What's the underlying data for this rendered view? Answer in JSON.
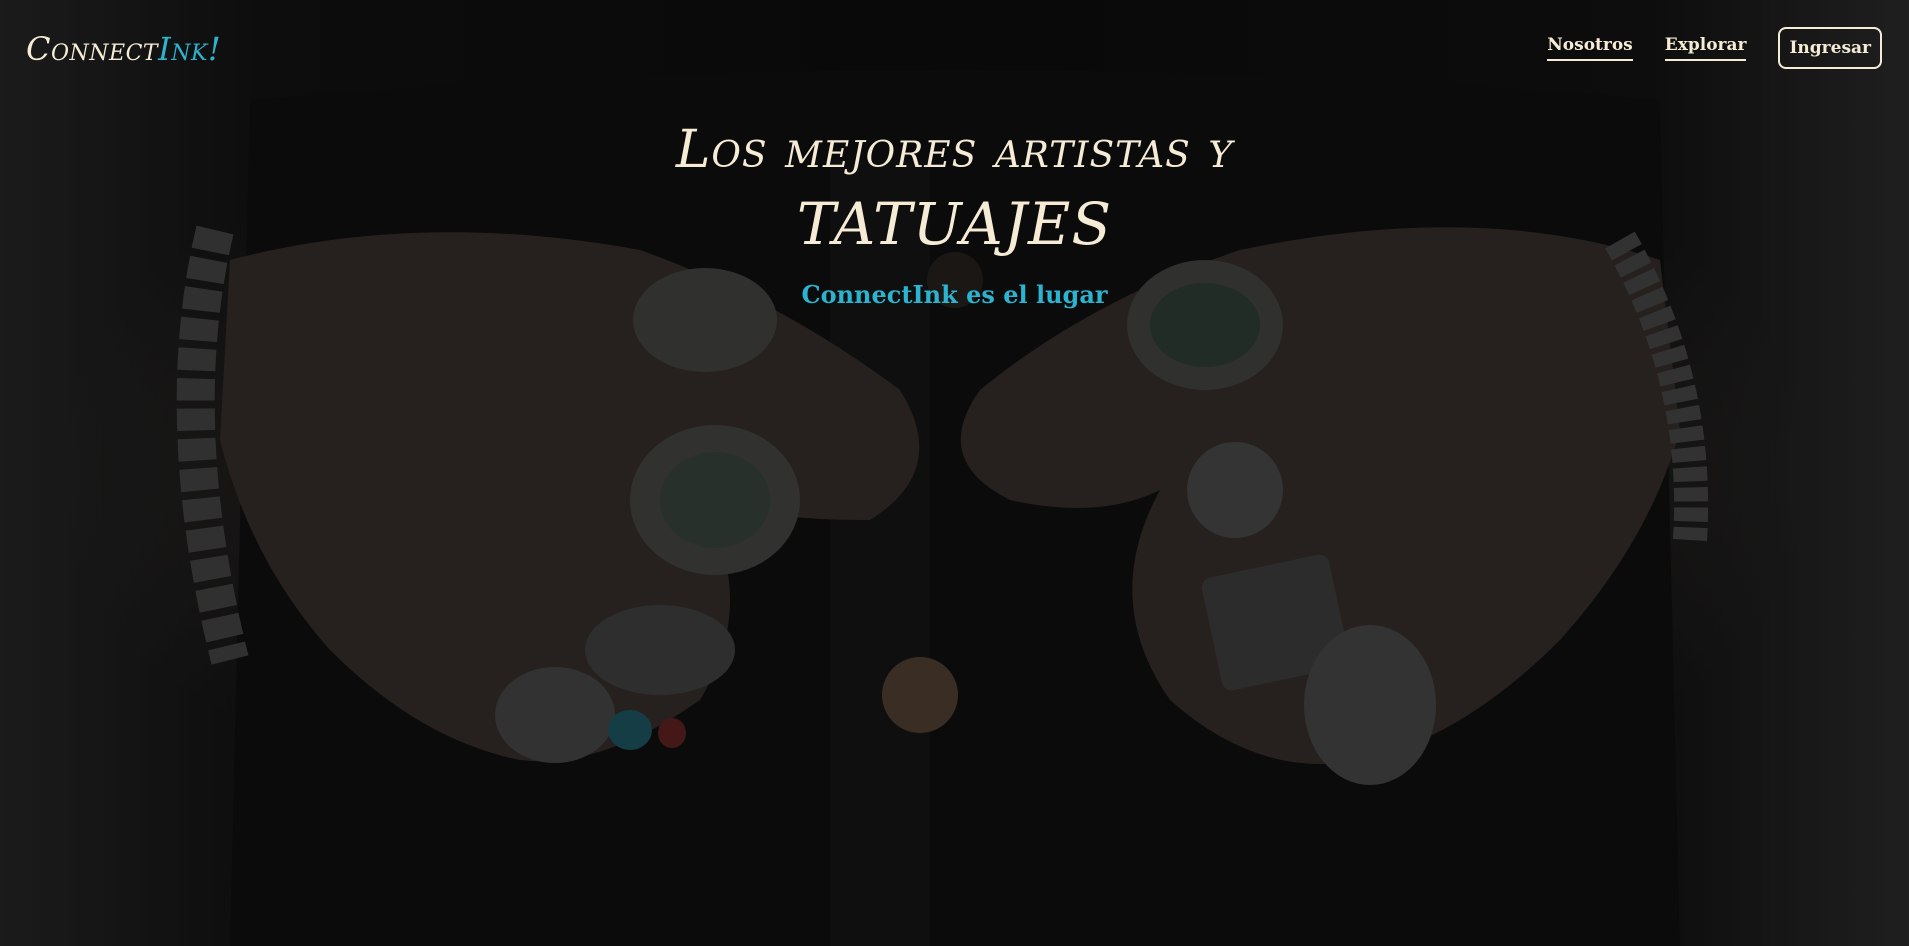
{
  "brand": {
    "logo_part1": "Connect",
    "logo_part2": "Ink!",
    "accent_color": "#2bb3cf",
    "text_color": "#f6ecd6"
  },
  "nav": {
    "items": [
      {
        "label": "Nosotros"
      },
      {
        "label": "Explorar"
      }
    ],
    "login_label": "Ingresar"
  },
  "hero": {
    "line1": "Los mejores artistas y",
    "line2": "TATUAJES",
    "subtitle": "ConnectInk es el lugar",
    "background": "photo of tattooed hands wearing silver rings (dark overlay)"
  }
}
